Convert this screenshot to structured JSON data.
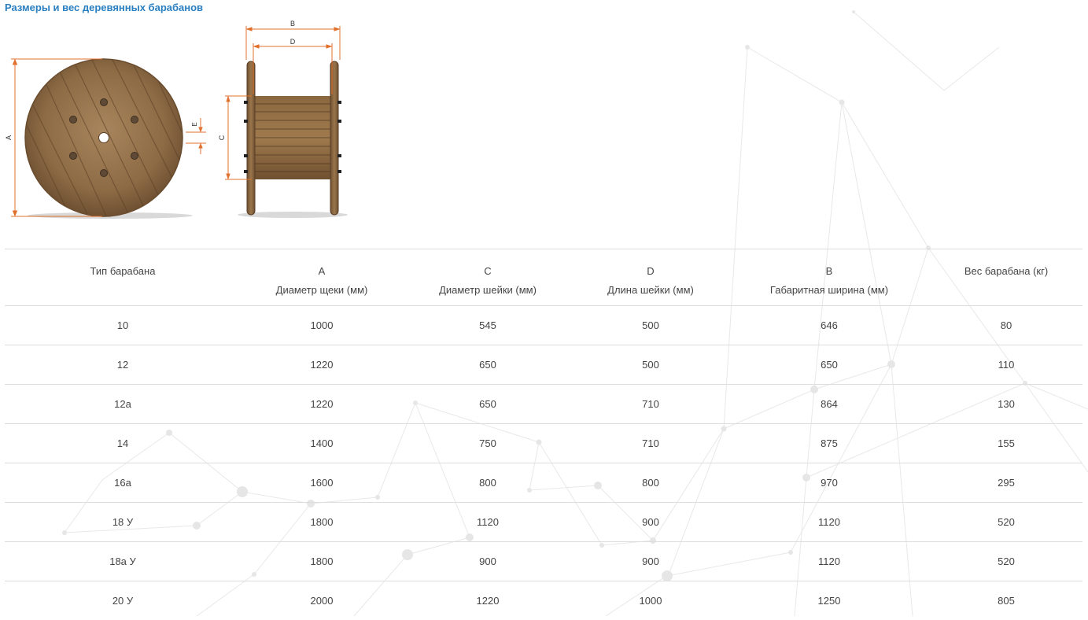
{
  "page": {
    "title": "Размеры и вес деревянных барабанов"
  },
  "diagram": {
    "front_labels": {
      "a": "A",
      "e": "E"
    },
    "side_labels": {
      "b": "B",
      "d": "D",
      "c": "C"
    }
  },
  "colors": {
    "title": "#2a7fc1",
    "dimension_line": "#e0702c",
    "wood": "#8b6a45",
    "table_border": "#dddddd"
  },
  "table": {
    "headers": [
      {
        "letter": "",
        "label": "Тип барабана"
      },
      {
        "letter": "A",
        "label": "Диаметр щеки (мм)"
      },
      {
        "letter": "C",
        "label": "Диаметр шейки (мм)"
      },
      {
        "letter": "D",
        "label": "Длина шейки (мм)"
      },
      {
        "letter": "B",
        "label": "Габаритная ширина (мм)"
      },
      {
        "letter": "",
        "label": "Вес барабана (кг)"
      }
    ],
    "rows": [
      [
        "10",
        "1000",
        "545",
        "500",
        "646",
        "80"
      ],
      [
        "12",
        "1220",
        "650",
        "500",
        "650",
        "110"
      ],
      [
        "12а",
        "1220",
        "650",
        "710",
        "864",
        "130"
      ],
      [
        "14",
        "1400",
        "750",
        "710",
        "875",
        "155"
      ],
      [
        "16а",
        "1600",
        "800",
        "800",
        "970",
        "295"
      ],
      [
        "18 У",
        "1800",
        "1120",
        "900",
        "1120",
        "520"
      ],
      [
        "18а У",
        "1800",
        "900",
        "900",
        "1120",
        "520"
      ],
      [
        "20 У",
        "2000",
        "1220",
        "1000",
        "1250",
        "805"
      ]
    ]
  }
}
